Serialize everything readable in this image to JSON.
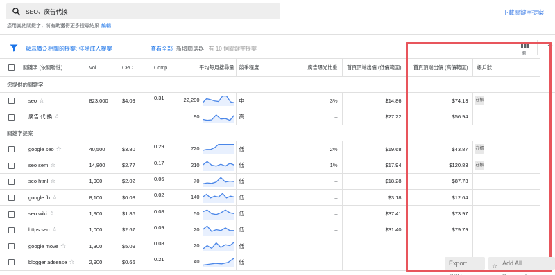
{
  "search": {
    "query": "SEO、廣告代換"
  },
  "header": {
    "download_label": "下載關鍵字提案",
    "hint_text": "您用其他關鍵字，將有助獲得更多搜尋結果",
    "hint_edit": "編輯"
  },
  "filters": {
    "text1": "顯示廣泛相關的提案: 排除成人提案",
    "text2": "查看全部",
    "add_filter": "新增篩選器",
    "count_text": "有 10 個關鍵字提案",
    "columns_label": "欄"
  },
  "table": {
    "headers": {
      "keyword": "關鍵字 (依關聯性)",
      "vol": "Vol",
      "cpc": "CPC",
      "comp": "Comp",
      "avg_searches": "平均每月搜尋量",
      "competition": "競爭程度",
      "impression_share": "廣告曝光比重",
      "top_bid_low": "首頁頂端出價 (低價範圍)",
      "top_bid_high": "首頁頂端出價 (高價範圍)",
      "cut": "帳戶狀"
    },
    "section_provided": "您提供的關鍵字",
    "section_ideas": "關鍵字提案",
    "provided": [
      {
        "keyword": "seo",
        "vol": "823,000",
        "cpc": "$4.09",
        "comp": "0.31",
        "searches": "22,200",
        "competition": "中",
        "share": "3%",
        "low": "$14.86",
        "high": "$74.13",
        "stub": "在帳"
      },
      {
        "keyword": "廣告 代 換",
        "vol": "",
        "cpc": "",
        "comp": "",
        "searches": "90",
        "competition": "高",
        "share": "–",
        "low": "$27.22",
        "high": "$56.94",
        "stub": ""
      }
    ],
    "ideas": [
      {
        "keyword": "google seo",
        "vol": "40,500",
        "cpc": "$3.80",
        "comp": "0.29",
        "searches": "720",
        "competition": "低",
        "share": "2%",
        "low": "$19.68",
        "high": "$43.87",
        "stub": "在帳"
      },
      {
        "keyword": "seo sem",
        "vol": "14,800",
        "cpc": "$2.77",
        "comp": "0.17",
        "searches": "210",
        "competition": "低",
        "share": "1%",
        "low": "$17.94",
        "high": "$120.83",
        "stub": "在帳"
      },
      {
        "keyword": "seo html",
        "vol": "1,900",
        "cpc": "$2.02",
        "comp": "0.06",
        "searches": "70",
        "competition": "低",
        "share": "–",
        "low": "$18.28",
        "high": "$87.73",
        "stub": ""
      },
      {
        "keyword": "google fb",
        "vol": "8,100",
        "cpc": "$0.08",
        "comp": "0.02",
        "searches": "140",
        "competition": "低",
        "share": "–",
        "low": "$3.18",
        "high": "$12.64",
        "stub": ""
      },
      {
        "keyword": "seo wiki",
        "vol": "1,900",
        "cpc": "$1.86",
        "comp": "0.08",
        "searches": "50",
        "competition": "低",
        "share": "–",
        "low": "$37.41",
        "high": "$73.97",
        "stub": ""
      },
      {
        "keyword": "https seo",
        "vol": "1,000",
        "cpc": "$2.67",
        "comp": "0.09",
        "searches": "20",
        "competition": "低",
        "share": "–",
        "low": "$31.40",
        "high": "$79.79",
        "stub": ""
      },
      {
        "keyword": "google move",
        "vol": "1,300",
        "cpc": "$5.09",
        "comp": "0.08",
        "searches": "20",
        "competition": "低",
        "share": "–",
        "low": "–",
        "high": "–",
        "stub": ""
      },
      {
        "keyword": "blogger adsense",
        "vol": "2,900",
        "cpc": "$0.66",
        "comp": "0.21",
        "searches": "40",
        "competition": "低",
        "share": "–",
        "low": "",
        "high": "",
        "stub": ""
      }
    ]
  },
  "buttons": {
    "export_csv": "Export CSV",
    "add_all": "Add All Keywords"
  },
  "colors": {
    "link": "#1a73e8",
    "sparkline": "#4a86e8",
    "highlight": "#e8555c"
  },
  "icons": [
    "search-icon",
    "filter-icon",
    "columns-icon",
    "chevron-up-icon",
    "star-icon"
  ]
}
